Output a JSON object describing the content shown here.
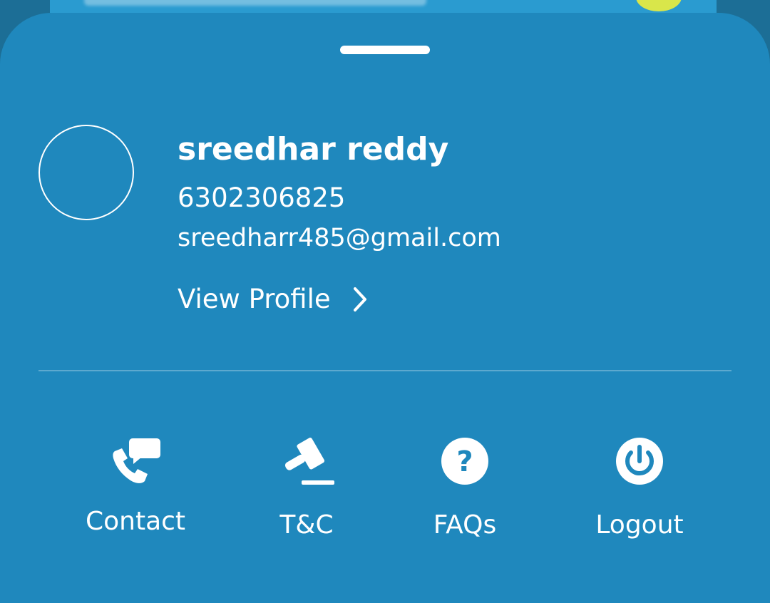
{
  "profile": {
    "name": "sreedhar reddy",
    "phone": "6302306825",
    "email": "sreedharr485@gmail.com",
    "view_profile_label": "View Profile"
  },
  "actions": [
    {
      "label": "Contact",
      "icon": "phone-chat-icon"
    },
    {
      "label": "T&C",
      "icon": "gavel-icon"
    },
    {
      "label": "FAQs",
      "icon": "question-circle-icon"
    },
    {
      "label": "Logout",
      "icon": "power-icon"
    }
  ],
  "colors": {
    "sheet": "#1f88bd",
    "backdrop": "#1c6e96",
    "text": "#ffffff"
  }
}
